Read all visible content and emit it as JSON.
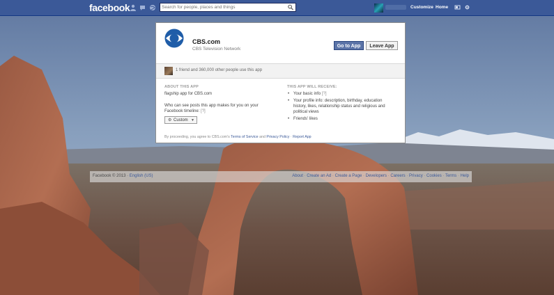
{
  "header": {
    "logo": "facebook",
    "search_placeholder": "Search for people, places and things",
    "nav": {
      "customize": "Customize",
      "home": "Home"
    }
  },
  "app": {
    "name": "CBS.com",
    "subtitle": "CBS Television Network",
    "go_button": "Go to App",
    "leave_button": "Leave App",
    "friends_text": "1 friend and 360,000 other people use this app",
    "about": {
      "heading": "ABOUT THIS APP",
      "description": "flagship app for CBS.com",
      "visibility_line1": "Who can see posts this app makes for you on your",
      "visibility_line2": "Facebook timeline:",
      "help": "[?]",
      "audience": "Custom"
    },
    "receive": {
      "heading": "THIS APP WILL RECEIVE:",
      "items": [
        {
          "lines": [
            "Your basic info"
          ],
          "help": "[?]"
        },
        {
          "lines": [
            "Your profile info: description, birthday, education",
            "history, likes, relationship status and religious and",
            "political views"
          ],
          "help": ""
        },
        {
          "lines": [
            "Friends' likes"
          ],
          "help": ""
        }
      ]
    },
    "disclaimer": {
      "prefix": "By proceeding, you agree to CBS.com's",
      "tos": "Terms of Service",
      "and": "and",
      "privacy": "Privacy Policy",
      "dot": "·",
      "report": "Report App"
    }
  },
  "footer": {
    "copyright": "Facebook © 2013 ·",
    "language": "English (US)",
    "links": [
      "About",
      "Create an Ad",
      "Create a Page",
      "Developers",
      "Careers",
      "Privacy",
      "Cookies",
      "Terms",
      "Help"
    ]
  }
}
